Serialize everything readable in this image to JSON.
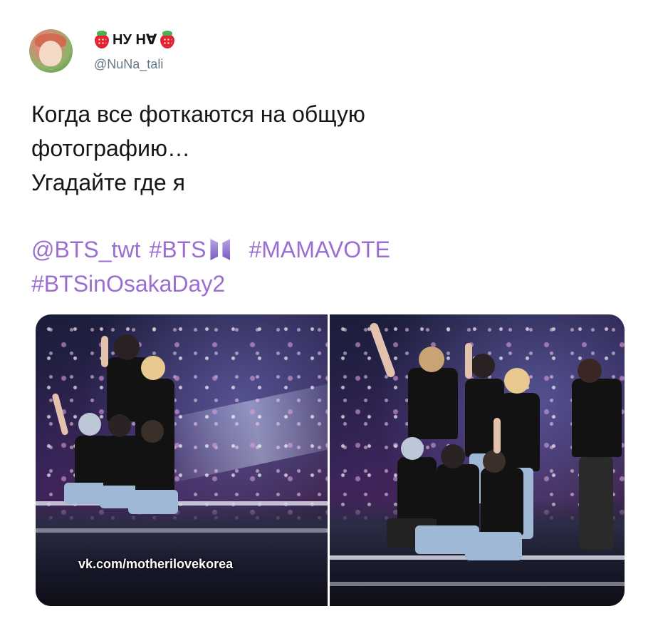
{
  "user": {
    "display_name": "НУ Нꓯ",
    "handle": "@NuNa_tali",
    "name_emoji_left": "strawberry-icon",
    "name_emoji_right": "strawberry-icon"
  },
  "tweet": {
    "lines": [
      "Когда все фоткаются на общую",
      "фотографию…",
      "Угадайте где я"
    ],
    "mentions": [
      "@BTS_twt"
    ],
    "hashtags_line1": [
      "#BTS",
      "#MAMAVOTE"
    ],
    "hashtags_line2": [
      "#BTSinOsakaDay2"
    ],
    "link_color": "#9b6fd2"
  },
  "media": {
    "photos": [
      {
        "id": "photo-left",
        "watermark": "vk.com/motherilovekorea"
      },
      {
        "id": "photo-right",
        "watermark": ""
      }
    ]
  }
}
